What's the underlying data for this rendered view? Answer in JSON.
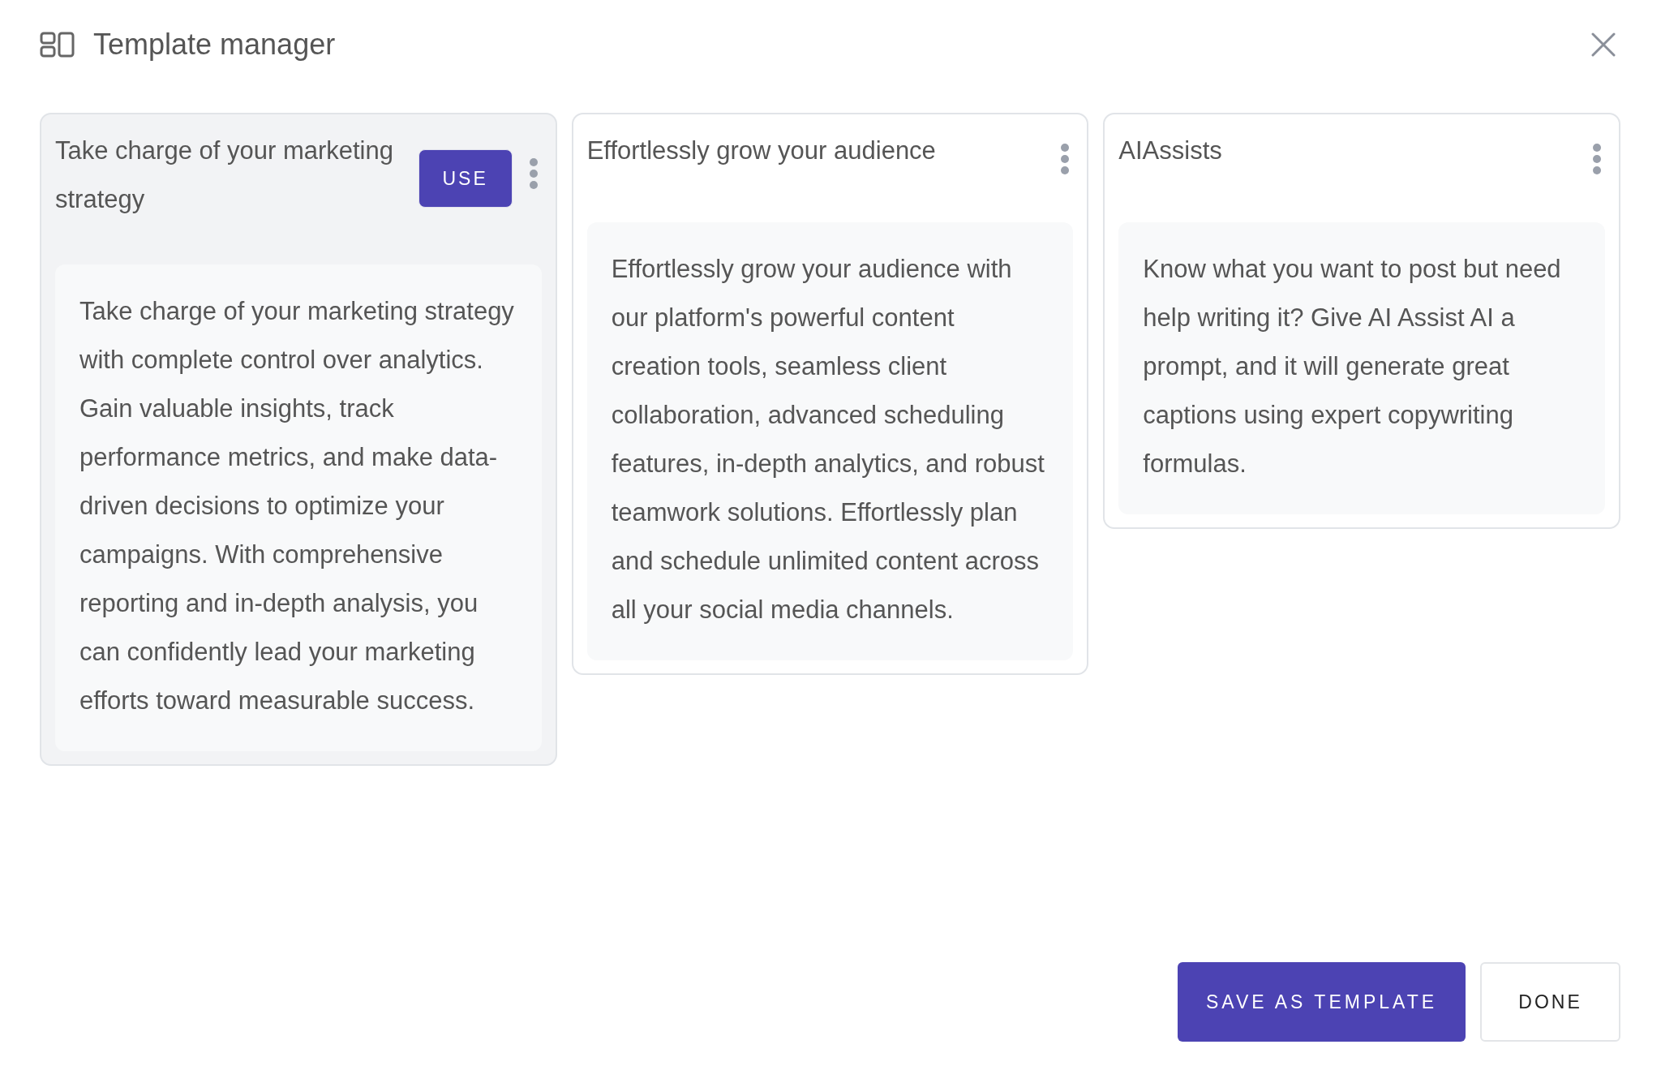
{
  "dialog": {
    "title": "Template manager"
  },
  "templates": [
    {
      "title": "Take charge of your marketing strategy",
      "selected": true,
      "use_button": "USE",
      "description": "Take charge of your marketing strategy with complete control over analytics. Gain valuable insights, track performance metrics, and make data-driven decisions to optimize your campaigns. With comprehensive reporting and in-depth analysis, you can confidently lead your marketing efforts toward measurable success."
    },
    {
      "title": "Effortlessly grow your audience",
      "selected": false,
      "description": "Effortlessly grow your audience with our platform's powerful content creation tools, seamless client collaboration, advanced scheduling features, in-depth analytics, and robust teamwork solutions. Effortlessly plan and schedule unlimited content across all your social media channels."
    },
    {
      "title": "AIAssists",
      "selected": false,
      "description": "Know what you want to post but need help writing it? Give AI Assist AI a prompt, and it will generate great captions using expert copywriting formulas."
    }
  ],
  "footer": {
    "primary_button": "SAVE AS TEMPLATE",
    "secondary_button": "DONE"
  }
}
